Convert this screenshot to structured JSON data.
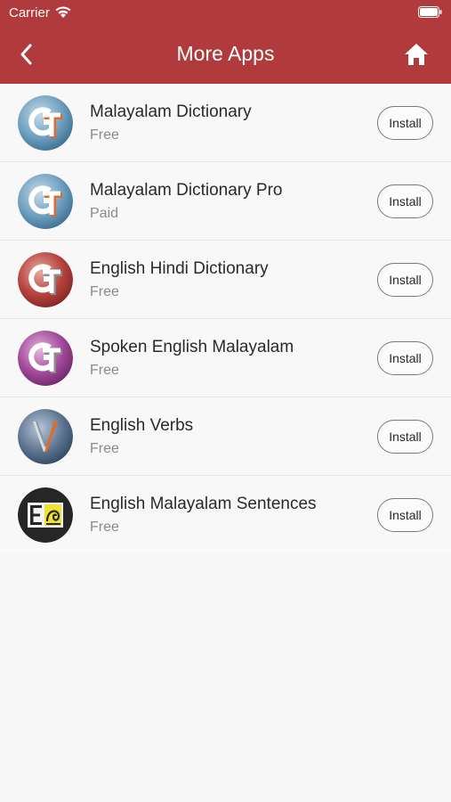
{
  "status": {
    "carrier": "Carrier"
  },
  "header": {
    "title": "More Apps",
    "color": "#b03a3c"
  },
  "apps": [
    {
      "name": "Malayalam Dictionary",
      "price": "Free",
      "install_label": "Install",
      "icon": "gt-blue-icon"
    },
    {
      "name": "Malayalam Dictionary Pro",
      "price": "Paid",
      "install_label": "Install",
      "icon": "gt-blue-icon"
    },
    {
      "name": "English Hindi Dictionary",
      "price": "Free",
      "install_label": "Install",
      "icon": "gt-red-icon"
    },
    {
      "name": "Spoken English Malayalam",
      "price": "Free",
      "install_label": "Install",
      "icon": "gt-purple-icon"
    },
    {
      "name": "English Verbs",
      "price": "Free",
      "install_label": "Install",
      "icon": "v-pen-icon"
    },
    {
      "name": "English Malayalam Sentences",
      "price": "Free",
      "install_label": "Install",
      "icon": "e-malayalam-icon"
    }
  ]
}
